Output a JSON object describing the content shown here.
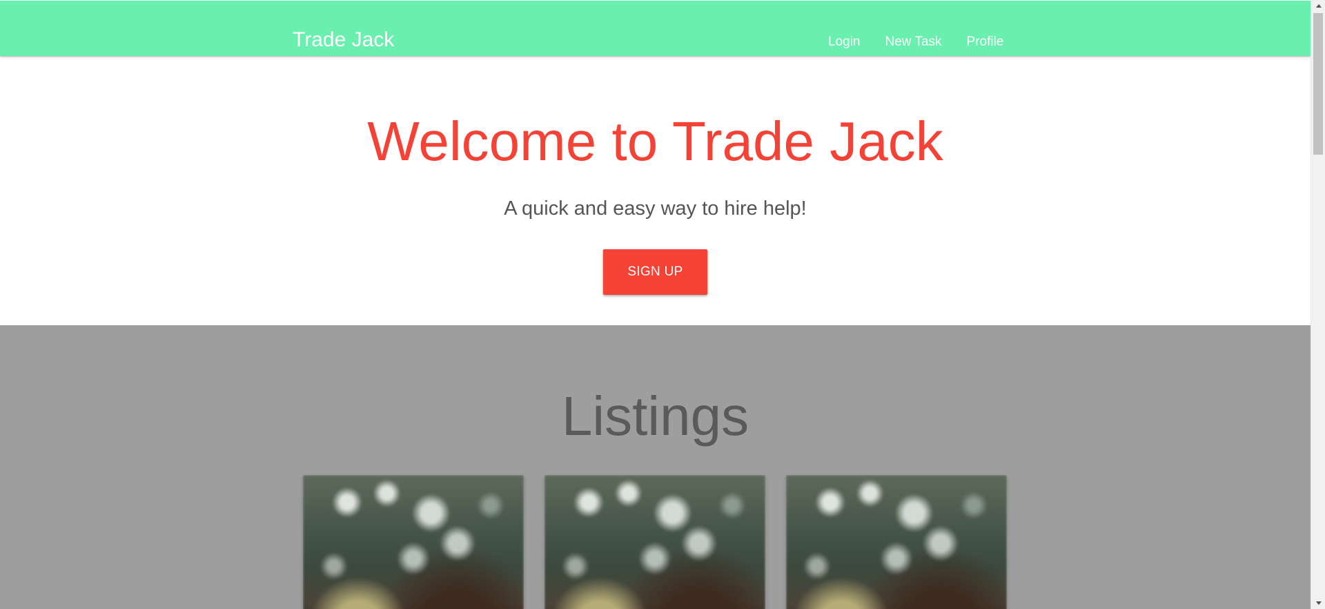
{
  "navbar": {
    "brand": "Trade Jack",
    "links": [
      {
        "label": "Login"
      },
      {
        "label": "New Task"
      },
      {
        "label": "Profile"
      }
    ],
    "color": "#69f0ae"
  },
  "hero": {
    "title": "Welcome to Trade Jack",
    "subtitle": "A quick and easy way to hire help!",
    "signup_label": "SIGN UP",
    "accent_color": "#f44336"
  },
  "listings": {
    "title": "Listings",
    "background": "#9e9e9e",
    "cards": [
      {
        "image": "blurred-forest-photo"
      },
      {
        "image": "blurred-forest-photo"
      },
      {
        "image": "blurred-forest-photo"
      }
    ]
  }
}
